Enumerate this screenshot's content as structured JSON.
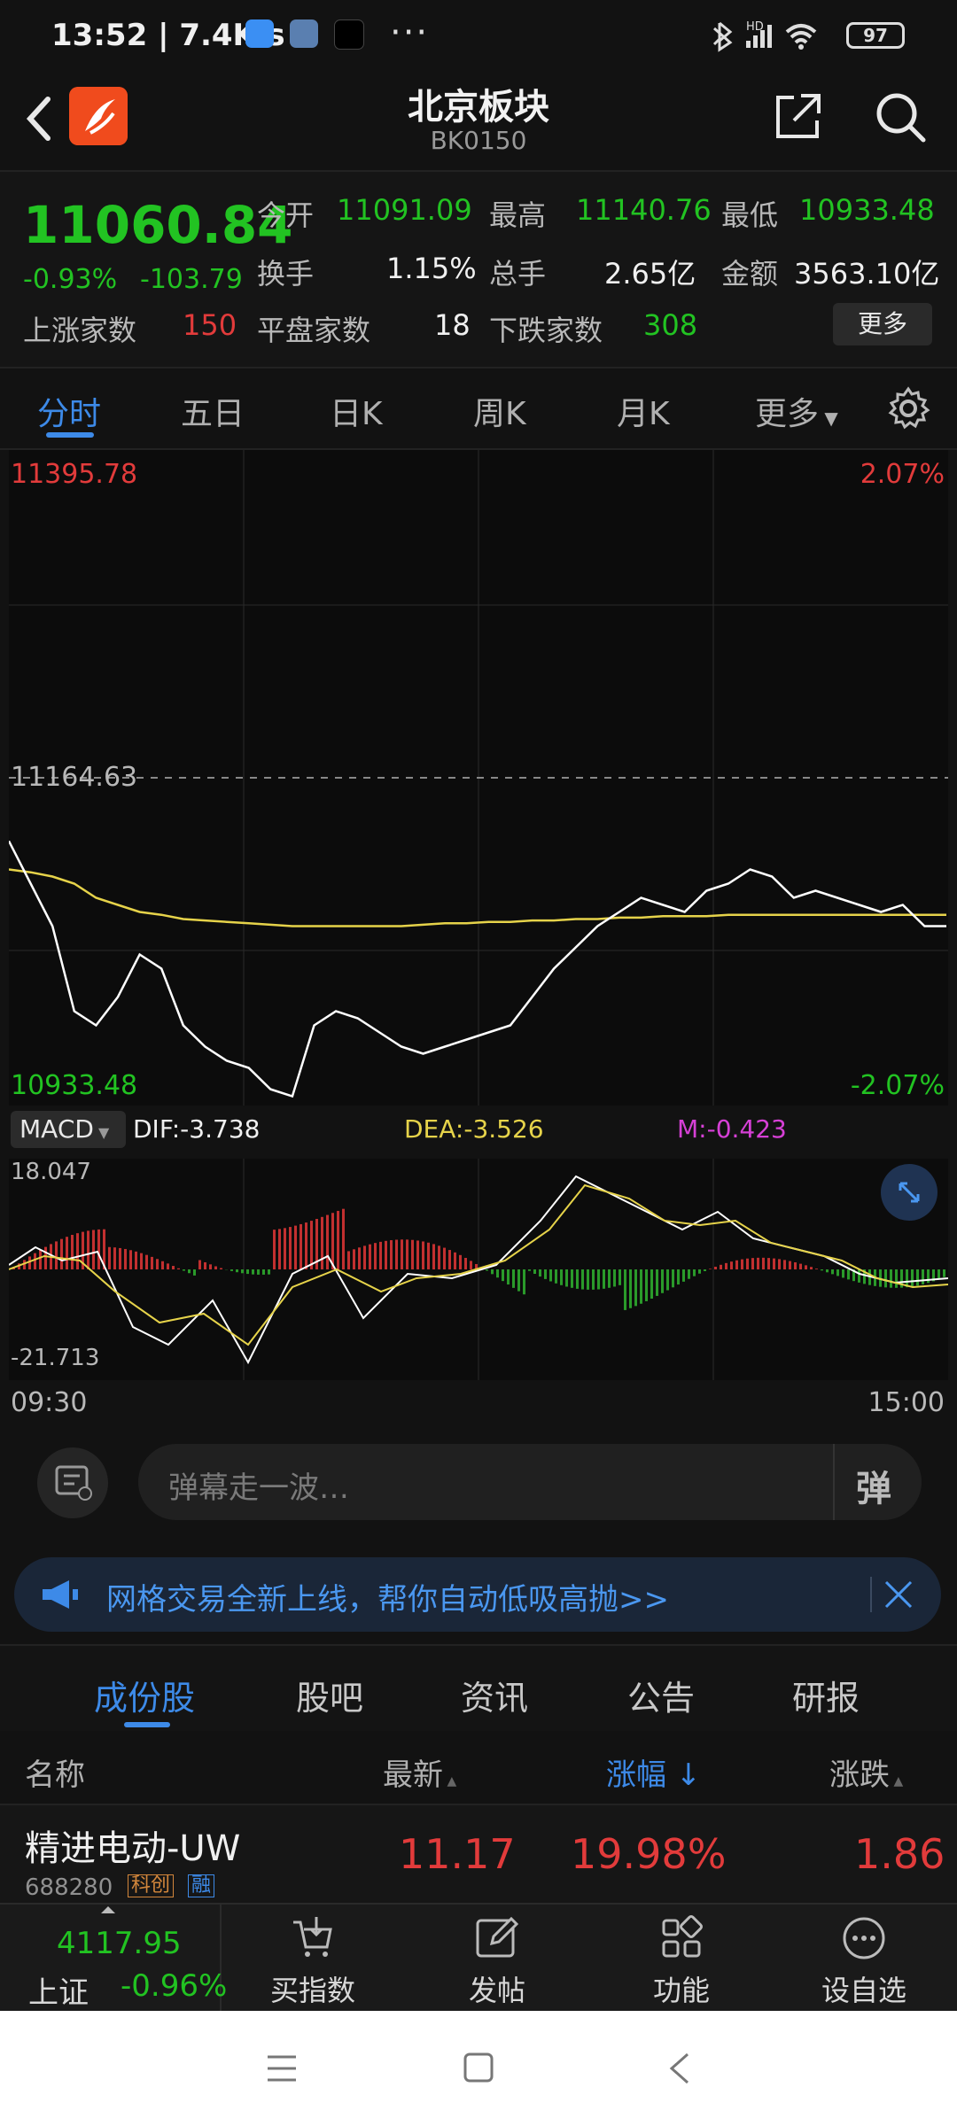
{
  "status_bar": {
    "time": "13:52 | 7.4K/s",
    "battery": "97"
  },
  "header": {
    "title": "北京板块",
    "code": "BK0150"
  },
  "quote": {
    "price": "11060.84",
    "change_pct": "-0.93%",
    "change_abs": "-103.79",
    "open_label": "今开",
    "open": "11091.09",
    "high_label": "最高",
    "high": "11140.76",
    "low_label": "最低",
    "low": "10933.48",
    "turnover_label": "换手",
    "turnover": "1.15%",
    "volume_label": "总手",
    "volume": "2.65亿",
    "amount_label": "金额",
    "amount": "3563.10亿",
    "up_label": "上涨家数",
    "up_count": "150",
    "flat_label": "平盘家数",
    "flat_count": "18",
    "down_label": "下跌家数",
    "down_count": "308",
    "more": "更多"
  },
  "tabs": [
    "分时",
    "五日",
    "日K",
    "周K",
    "月K",
    "更多"
  ],
  "chart": {
    "top_left": "11395.78",
    "top_right": "2.07%",
    "mid": "11164.63",
    "bottom_left": "10933.48",
    "bottom_right": "-2.07%",
    "macd_label": "MACD",
    "dif": "DIF:-3.738",
    "dea": "DEA:-3.526",
    "m": "M:-0.423",
    "macd_top": "18.047",
    "macd_bottom": "-21.713",
    "time_start": "09:30",
    "time_end": "15:00"
  },
  "chart_data": {
    "type": "line",
    "title": "",
    "ylim": [
      10933.48,
      11395.78
    ],
    "series": [
      {
        "values": [
          11120,
          11090,
          11060,
          11000,
          10990,
          11010,
          11040,
          11030,
          10990,
          10975,
          10965,
          10960,
          10945,
          10940,
          10990,
          11000,
          10995,
          10985,
          10975,
          10970,
          10975,
          10980,
          10985,
          10990,
          11010,
          11030,
          11045,
          11060,
          11070,
          11080,
          11075,
          11070,
          11085,
          11090,
          11100,
          11095,
          11080,
          11085,
          11080,
          11075,
          11070,
          11075,
          11060,
          11060
        ]
      },
      {
        "values": [
          11100,
          11098,
          11095,
          11090,
          11080,
          11075,
          11070,
          11068,
          11065,
          11064,
          11063,
          11062,
          11061,
          11060,
          11060,
          11060,
          11060,
          11060,
          11060,
          11061,
          11062,
          11062,
          11063,
          11063,
          11064,
          11064,
          11065,
          11065,
          11066,
          11066,
          11067,
          11067,
          11067,
          11068,
          11068,
          11068,
          11068,
          11068,
          11068,
          11068,
          11068,
          11068,
          11068,
          11068
        ]
      }
    ]
  },
  "danmu": {
    "placeholder": "弹幕走一波…",
    "button": "弹"
  },
  "banner": {
    "text": "网格交易全新上线，帮你自动低吸高抛>>"
  },
  "subtabs": [
    "成份股",
    "股吧",
    "资讯",
    "公告",
    "研报"
  ],
  "table": {
    "headers": {
      "name": "名称",
      "latest": "最新",
      "pct": "涨幅 ↓",
      "chg": "涨跌"
    },
    "rows": [
      {
        "name": "精进电动-UW",
        "code": "688280",
        "tag1": "科创",
        "tag2": "融",
        "latest": "11.17",
        "pct": "19.98%",
        "chg": "1.86"
      }
    ]
  },
  "bottom_nav": {
    "index_value": "4117.95",
    "index_name": "上证",
    "index_change": "-0.96%",
    "items": [
      "买指数",
      "发帖",
      "功能",
      "设自选"
    ]
  },
  "colors": {
    "up": "#e23b3b",
    "down": "#22c322",
    "accent": "#3d8ae8",
    "avg_line": "#e6d34a"
  }
}
